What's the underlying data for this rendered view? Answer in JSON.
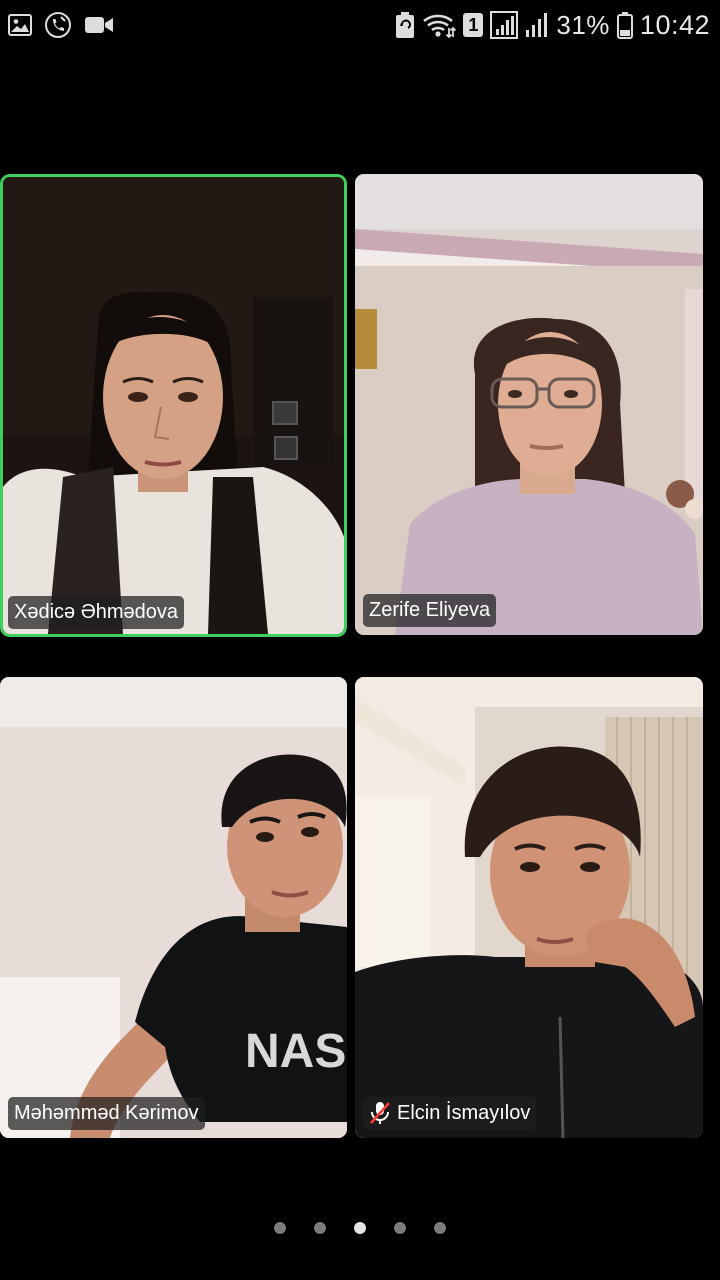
{
  "status_bar": {
    "left_icons": [
      "image-icon",
      "call-icon",
      "video-icon"
    ],
    "right_icons": [
      "battery-saver-icon",
      "wifi-icon",
      "sim-1-icon",
      "signal-icon",
      "signal-icon"
    ],
    "sim_badge": "1",
    "battery_percent": "31%",
    "time": "10:42"
  },
  "participants": [
    {
      "name": "Xədicə Əhmədova",
      "active_speaker": true,
      "muted": false
    },
    {
      "name": "Zerife Eliyeva",
      "active_speaker": false,
      "muted": false
    },
    {
      "name": "Məhəmməd Kərimov",
      "active_speaker": false,
      "muted": false
    },
    {
      "name": "Elcin İsmayılov",
      "active_speaker": false,
      "muted": true
    }
  ],
  "pager": {
    "pages": 5,
    "current": 3
  },
  "colors": {
    "active_border": "#3fcf5c",
    "background": "#000000",
    "mute_icon": "#ff3b30"
  }
}
